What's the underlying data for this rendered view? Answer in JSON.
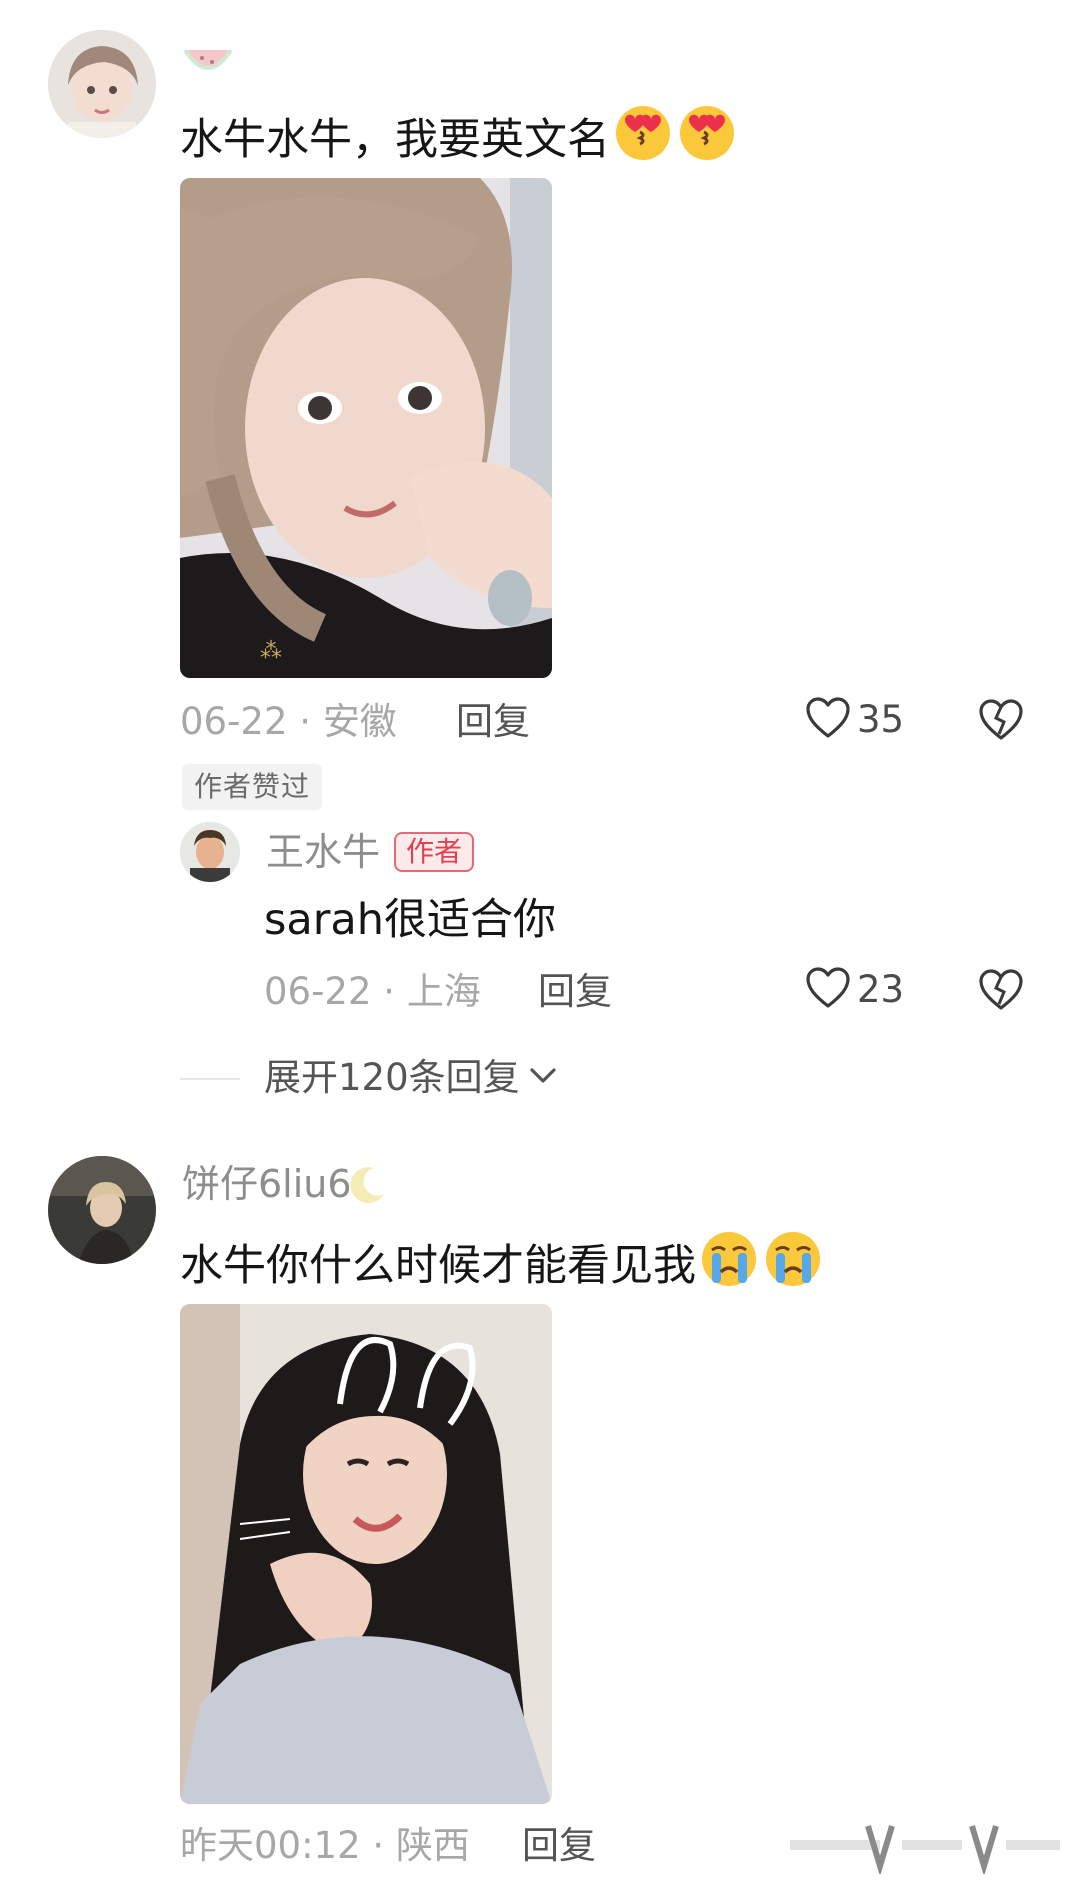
{
  "comments": [
    {
      "username": "",
      "text": "水牛水牛，我要英文名",
      "emoji": "heart-eyes-kiss-emoji",
      "date": "06-22",
      "location": "安徽",
      "reply_label": "回复",
      "likes": "35",
      "badge": "作者赞过"
    },
    {
      "username": "饼仔6liu6",
      "text": "水牛你什么时候才能看见我",
      "emoji": "crying-emoji",
      "date": "昨天00:12",
      "location": "陕西",
      "reply_label": "回复"
    }
  ],
  "reply": {
    "username": "王水牛",
    "author_tag": "作者",
    "text": "sarah很适合你",
    "date": "06-22",
    "location": "上海",
    "reply_label": "回复",
    "likes": "23"
  },
  "expand": {
    "label": "展开120条回复"
  },
  "colors": {
    "like_outline": "#3a3a3a",
    "author_tag": "#e0404f",
    "muted": "#a7a7a7"
  }
}
